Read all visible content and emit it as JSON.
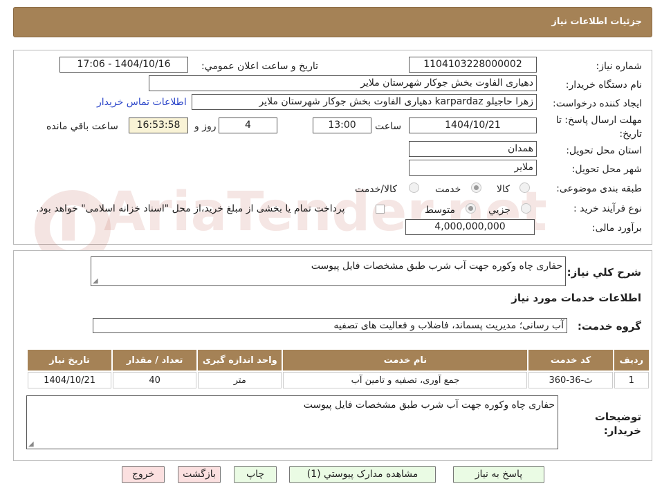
{
  "header": {
    "title": "جزئیات اطلاعات نیاز"
  },
  "form": {
    "need_number_label": "شماره نیاز:",
    "need_number": "1104103228000002",
    "announce_label": "تاریخ و ساعت اعلان عمومي:",
    "announce_value": "1404/10/16 - 17:06",
    "buyer_org_label": "نام دستگاه خریدار:",
    "buyer_org": "دهیاری الفاوت بخش جوکار شهرستان ملایر",
    "requester_label": "ایجاد کننده درخواست:",
    "requester": "زهرا حاجیلو karpardaz دهیاری الفاوت بخش جوکار شهرستان ملایر",
    "contact_link": "اطلاعات تماس خریدار",
    "deadline_label": "مهلت ارسال پاسخ: تا تاریخ:",
    "deadline_date": "1404/10/21",
    "time_label": "ساعت",
    "deadline_time": "13:00",
    "days_value": "4",
    "days_label": "روز و",
    "remaining_time": "16:53:58",
    "remaining_label": "ساعت باقي مانده",
    "province_label": "استان محل تحویل:",
    "province": "همدان",
    "city_label": "شهر محل تحویل:",
    "city": "ملایر",
    "category_label": "طبقه بندی موضوعی:",
    "category_options": [
      "کالا",
      "خدمت",
      "کالا/خدمت"
    ],
    "category_selected": "خدمت",
    "process_label": "نوع فرآیند خرید :",
    "process_options": [
      "جزیي",
      "متوسط"
    ],
    "process_selected": "متوسط",
    "payment_note": "پرداخت تمام یا بخشی از مبلغ خرید،از محل \"اسناد خزانه اسلامی\" خواهد بود.",
    "budget_label": "برآورد مالی:",
    "budget": "4,000,000,000"
  },
  "summary": {
    "label": "شرح کلي نیاز:",
    "text": "حفاری چاه وکوره جهت آب شرب طبق مشخصات  فایل پیوست"
  },
  "services": {
    "title": "اطلاعات خدمات مورد نیاز",
    "group_label": "گروه خدمت:",
    "group_value": "آب رسانی؛ مدیریت پسماند، فاضلاب و فعالیت های تصفیه",
    "columns": [
      "ردیف",
      "کد خدمت",
      "نام خدمت",
      "واحد اندازه گیری",
      "تعداد / مقدار",
      "تاریخ نیاز"
    ],
    "rows": [
      [
        "1",
        "ث-36-360",
        "جمع آوری، تصفیه و تامین آب",
        "متر",
        "40",
        "1404/10/21"
      ]
    ]
  },
  "buyer_notes": {
    "label": "توضیحات خریدار:",
    "text": "حفاری چاه وکوره جهت آب شرب طبق مشخصات  فایل پیوست"
  },
  "buttons": {
    "reply": "پاسخ به نیاز",
    "attachments": "مشاهده مدارک پیوستي (1)",
    "print": "چاپ",
    "back": "بازگشت",
    "exit": "خروج"
  },
  "watermark": {
    "text": "AriaTender.net"
  },
  "colors": {
    "header_bg": "#a58256",
    "link": "#2b45c9",
    "remaining_bg": "#f9f3d6",
    "button_green": "#eafbe4",
    "button_pink": "#fbe0e0"
  }
}
